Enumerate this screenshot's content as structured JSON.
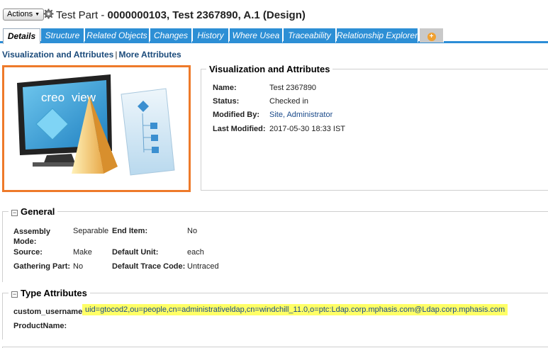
{
  "header": {
    "actions_label": "Actions",
    "title_prefix": "Test Part - ",
    "title_bold": "0000000103, Test 2367890, A.1 (Design)"
  },
  "tabs": [
    {
      "label": "Details"
    },
    {
      "label": "Structure"
    },
    {
      "label": "Related Objects"
    },
    {
      "label": "Changes"
    },
    {
      "label": "History"
    },
    {
      "label": "Where Usea"
    },
    {
      "label": "Traceability"
    },
    {
      "label": "Relationship Explorer"
    }
  ],
  "sublinks": {
    "visualization": "Visualization and Attributes",
    "more": "More Attributes"
  },
  "thumbnail": {
    "brand_text": "creo",
    "brand_suffix": "view"
  },
  "visualization": {
    "title": "Visualization and Attributes",
    "name_label": "Name:",
    "name_value": "Test 2367890",
    "status_label": "Status:",
    "status_value": "Checked in",
    "modified_by_label": "Modified By:",
    "modified_by_value": "Site, Administrator",
    "last_modified_label": "Last Modified:",
    "last_modified_value": "2017-05-30 18:33 IST"
  },
  "general": {
    "title": "General",
    "assembly_mode_label_1": "Assembly",
    "assembly_mode_label_2": "Mode:",
    "assembly_mode_value": "Separable",
    "end_item_label": "End Item:",
    "end_item_value": "No",
    "source_label": "Source:",
    "source_value": "Make",
    "default_unit_label": "Default Unit:",
    "default_unit_value": "each",
    "gathering_part_label": "Gathering Part:",
    "gathering_part_value": "No",
    "default_trace_code_label": "Default Trace Code:",
    "default_trace_code_value": "Untraced"
  },
  "type_attributes": {
    "title": "Type Attributes",
    "custom_username_label": "custom_username:",
    "custom_username_value": "uid=gtocod2,ou=people,cn=administrativeldap,cn=windchill_11.0,o=ptc:Ldap.corp.mphasis.com@Ldap.corp.mphasis.com",
    "product_name_label": "ProductName:"
  },
  "colors": {
    "tab_blue": "#2d8fd5",
    "thumb_border": "#ee7a2a",
    "highlight": "#ffff66",
    "link": "#1a4a8a"
  }
}
